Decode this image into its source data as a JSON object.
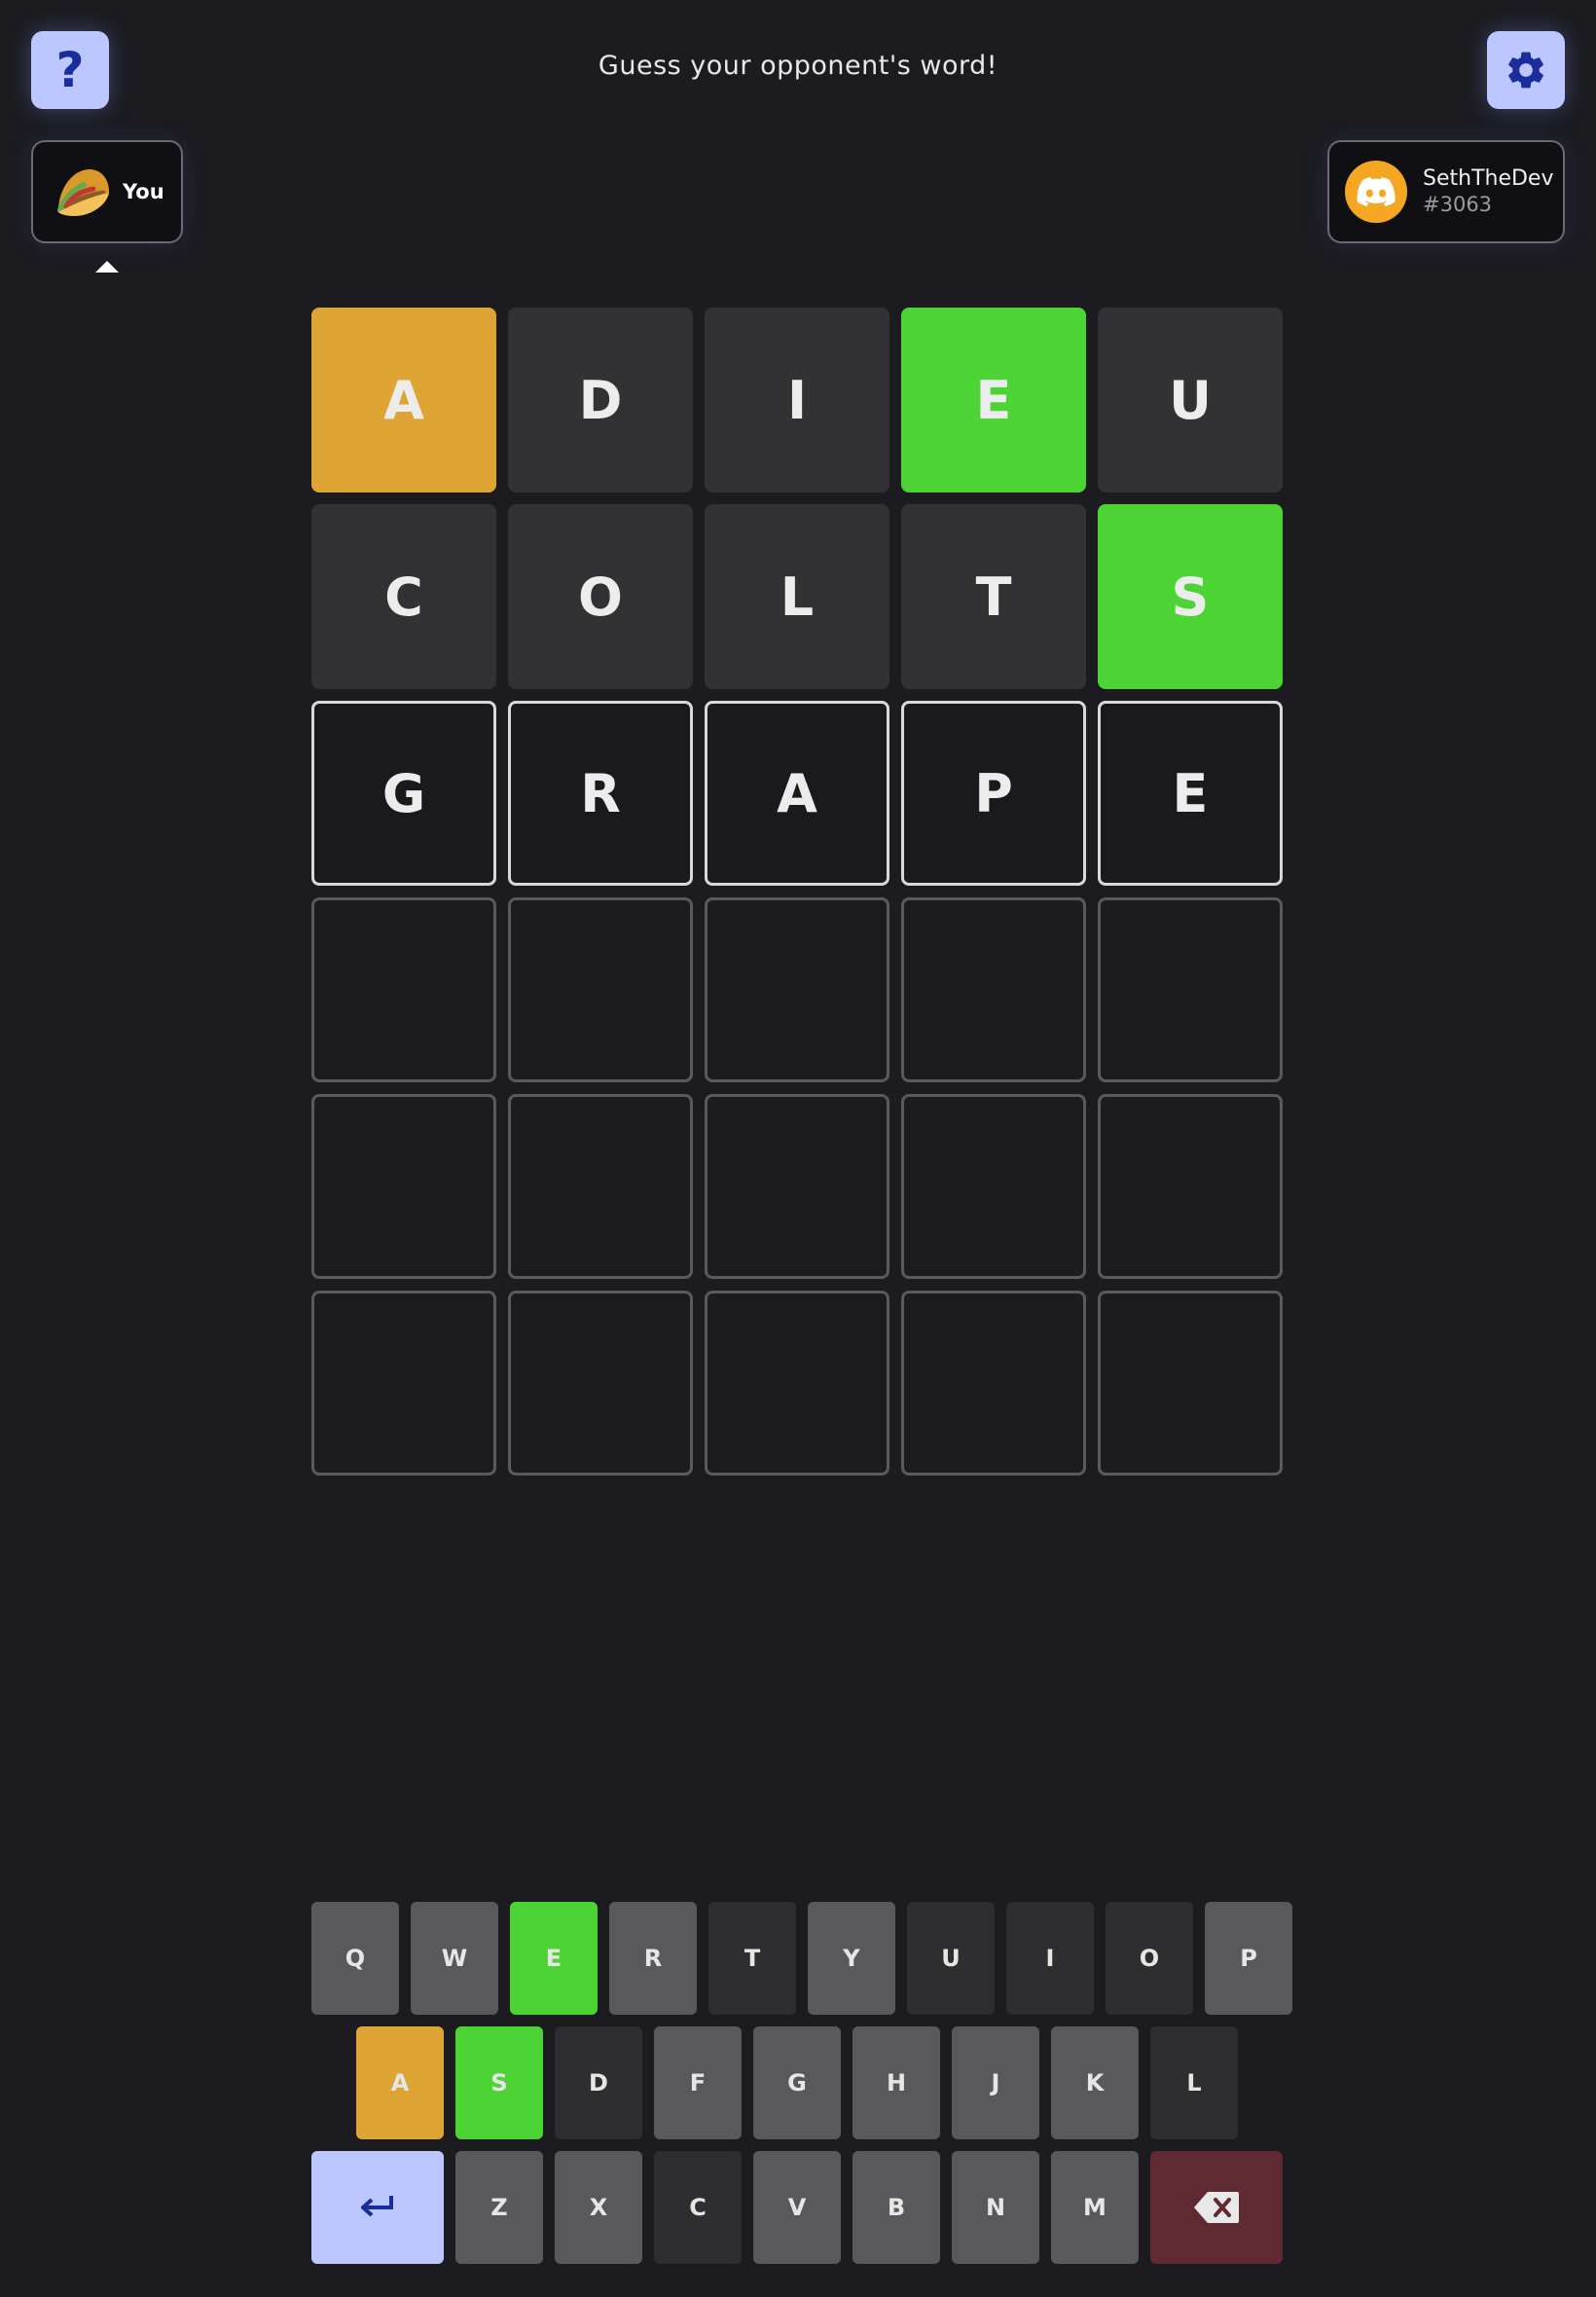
{
  "header": {
    "prompt": "Guess your opponent's word!"
  },
  "buttons": {
    "help_label": "?",
    "help_icon": "question-mark-icon",
    "settings_icon": "gear-icon"
  },
  "players": {
    "you": {
      "name": "You",
      "avatar_icon": "taco-icon"
    },
    "opponent": {
      "name": "SethTheDev",
      "tag": "#3063",
      "avatar_icon": "discord-icon",
      "avatar_color": "#f5a623"
    }
  },
  "colors": {
    "background": "#1b1b20",
    "correct": "#4cd334",
    "present": "#dea535",
    "absent": "#323234",
    "key_unused": "#59595d",
    "accent": "#bcc6ff",
    "delete_key": "#5f2a31"
  },
  "board": {
    "rows": [
      [
        {
          "letter": "A",
          "state": "present"
        },
        {
          "letter": "D",
          "state": "absent"
        },
        {
          "letter": "I",
          "state": "absent"
        },
        {
          "letter": "E",
          "state": "correct"
        },
        {
          "letter": "U",
          "state": "absent"
        }
      ],
      [
        {
          "letter": "C",
          "state": "absent"
        },
        {
          "letter": "O",
          "state": "absent"
        },
        {
          "letter": "L",
          "state": "absent"
        },
        {
          "letter": "T",
          "state": "absent"
        },
        {
          "letter": "S",
          "state": "correct"
        }
      ],
      [
        {
          "letter": "G",
          "state": "typed"
        },
        {
          "letter": "R",
          "state": "typed"
        },
        {
          "letter": "A",
          "state": "typed"
        },
        {
          "letter": "P",
          "state": "typed"
        },
        {
          "letter": "E",
          "state": "typed"
        }
      ],
      [
        {
          "letter": "",
          "state": "empty"
        },
        {
          "letter": "",
          "state": "empty"
        },
        {
          "letter": "",
          "state": "empty"
        },
        {
          "letter": "",
          "state": "empty"
        },
        {
          "letter": "",
          "state": "empty"
        }
      ],
      [
        {
          "letter": "",
          "state": "empty"
        },
        {
          "letter": "",
          "state": "empty"
        },
        {
          "letter": "",
          "state": "empty"
        },
        {
          "letter": "",
          "state": "empty"
        },
        {
          "letter": "",
          "state": "empty"
        }
      ],
      [
        {
          "letter": "",
          "state": "empty"
        },
        {
          "letter": "",
          "state": "empty"
        },
        {
          "letter": "",
          "state": "empty"
        },
        {
          "letter": "",
          "state": "empty"
        },
        {
          "letter": "",
          "state": "empty"
        }
      ]
    ]
  },
  "keyboard": {
    "rows": [
      [
        {
          "label": "Q",
          "state": "unused"
        },
        {
          "label": "W",
          "state": "unused"
        },
        {
          "label": "E",
          "state": "correct"
        },
        {
          "label": "R",
          "state": "unused"
        },
        {
          "label": "T",
          "state": "absent"
        },
        {
          "label": "Y",
          "state": "unused"
        },
        {
          "label": "U",
          "state": "absent"
        },
        {
          "label": "I",
          "state": "absent"
        },
        {
          "label": "O",
          "state": "absent"
        },
        {
          "label": "P",
          "state": "unused"
        }
      ],
      [
        {
          "label": "A",
          "state": "present"
        },
        {
          "label": "S",
          "state": "correct"
        },
        {
          "label": "D",
          "state": "absent"
        },
        {
          "label": "F",
          "state": "unused"
        },
        {
          "label": "G",
          "state": "unused"
        },
        {
          "label": "H",
          "state": "unused"
        },
        {
          "label": "J",
          "state": "unused"
        },
        {
          "label": "K",
          "state": "unused"
        },
        {
          "label": "L",
          "state": "absent"
        }
      ],
      [
        {
          "label": "",
          "state": "enter",
          "icon": "enter-icon"
        },
        {
          "label": "Z",
          "state": "unused"
        },
        {
          "label": "X",
          "state": "unused"
        },
        {
          "label": "C",
          "state": "absent"
        },
        {
          "label": "V",
          "state": "unused"
        },
        {
          "label": "B",
          "state": "unused"
        },
        {
          "label": "N",
          "state": "unused"
        },
        {
          "label": "M",
          "state": "unused"
        },
        {
          "label": "",
          "state": "backspace",
          "icon": "backspace-icon"
        }
      ]
    ]
  }
}
